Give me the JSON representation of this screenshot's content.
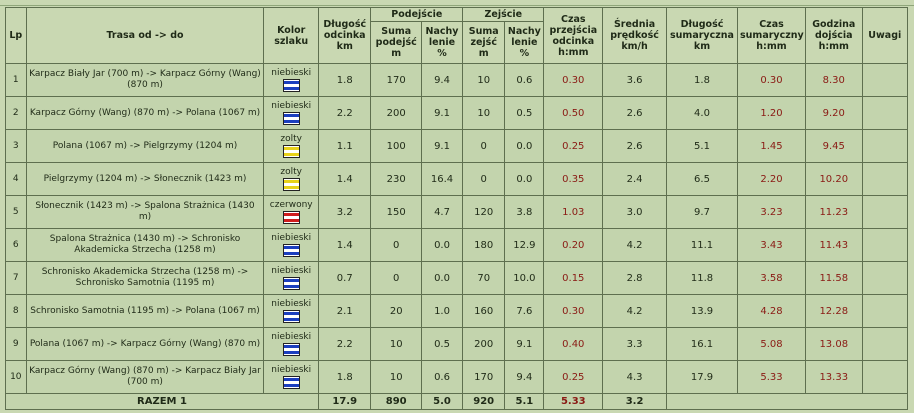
{
  "header": {
    "lp": "Lp",
    "route": "Trasa od -> do",
    "trail_color": "Kolor szlaku",
    "segment_length": "Długość odcinka km",
    "ascent_group": "Podejście",
    "ascent_sum": "Suma podejść m",
    "ascent_grade": "Nachy lenie %",
    "descent_group": "Zejście",
    "descent_sum": "Suma zejść m",
    "descent_grade": "Nachy lenie %",
    "segment_time": "Czas przejścia odcinka h:mm",
    "avg_speed": "Średnia prędkość km/h",
    "total_length": "Długość sumaryczna km",
    "total_time": "Czas sumaryczny h:mm",
    "arrival_time": "Godzina dojścia h:mm",
    "notes": "Uwagi"
  },
  "rows": [
    {
      "lp": "1",
      "route": "Karpacz Biały Jar (700 m) -> Karpacz Górny (Wang) (870 m)",
      "color_name": "niebieski",
      "color": "blue",
      "len": "1.8",
      "asc": "170",
      "asc_grade": "9.4",
      "desc": "10",
      "desc_grade": "0.6",
      "time": "0.30",
      "speed": "3.6",
      "sum_len": "1.8",
      "sum_time": "0.30",
      "arrival": "8.30",
      "notes": ""
    },
    {
      "lp": "2",
      "route": "Karpacz Górny (Wang) (870 m) -> Polana (1067 m)",
      "color_name": "niebieski",
      "color": "blue",
      "len": "2.2",
      "asc": "200",
      "asc_grade": "9.1",
      "desc": "10",
      "desc_grade": "0.5",
      "time": "0.50",
      "speed": "2.6",
      "sum_len": "4.0",
      "sum_time": "1.20",
      "arrival": "9.20",
      "notes": ""
    },
    {
      "lp": "3",
      "route": "Polana (1067 m) -> Pielgrzymy (1204 m)",
      "color_name": "zolty",
      "color": "yellow",
      "len": "1.1",
      "asc": "100",
      "asc_grade": "9.1",
      "desc": "0",
      "desc_grade": "0.0",
      "time": "0.25",
      "speed": "2.6",
      "sum_len": "5.1",
      "sum_time": "1.45",
      "arrival": "9.45",
      "notes": ""
    },
    {
      "lp": "4",
      "route": "Pielgrzymy (1204 m) -> Słonecznik (1423 m)",
      "color_name": "zolty",
      "color": "yellow",
      "len": "1.4",
      "asc": "230",
      "asc_grade": "16.4",
      "desc": "0",
      "desc_grade": "0.0",
      "time": "0.35",
      "speed": "2.4",
      "sum_len": "6.5",
      "sum_time": "2.20",
      "arrival": "10.20",
      "notes": ""
    },
    {
      "lp": "5",
      "route": "Słonecznik (1423 m) -> Spalona Strażnica (1430 m)",
      "color_name": "czerwony",
      "color": "red",
      "len": "3.2",
      "asc": "150",
      "asc_grade": "4.7",
      "desc": "120",
      "desc_grade": "3.8",
      "time": "1.03",
      "speed": "3.0",
      "sum_len": "9.7",
      "sum_time": "3.23",
      "arrival": "11.23",
      "notes": ""
    },
    {
      "lp": "6",
      "route": "Spalona Strażnica (1430 m) -> Schronisko Akademicka Strzecha (1258 m)",
      "color_name": "niebieski",
      "color": "blue",
      "len": "1.4",
      "asc": "0",
      "asc_grade": "0.0",
      "desc": "180",
      "desc_grade": "12.9",
      "time": "0.20",
      "speed": "4.2",
      "sum_len": "11.1",
      "sum_time": "3.43",
      "arrival": "11.43",
      "notes": ""
    },
    {
      "lp": "7",
      "route": "Schronisko Akademicka Strzecha (1258 m) -> Schronisko Samotnia (1195 m)",
      "color_name": "niebieski",
      "color": "blue",
      "len": "0.7",
      "asc": "0",
      "asc_grade": "0.0",
      "desc": "70",
      "desc_grade": "10.0",
      "time": "0.15",
      "speed": "2.8",
      "sum_len": "11.8",
      "sum_time": "3.58",
      "arrival": "11.58",
      "notes": ""
    },
    {
      "lp": "8",
      "route": "Schronisko Samotnia (1195 m) -> Polana (1067 m)",
      "color_name": "niebieski",
      "color": "blue",
      "len": "2.1",
      "asc": "20",
      "asc_grade": "1.0",
      "desc": "160",
      "desc_grade": "7.6",
      "time": "0.30",
      "speed": "4.2",
      "sum_len": "13.9",
      "sum_time": "4.28",
      "arrival": "12.28",
      "notes": ""
    },
    {
      "lp": "9",
      "route": "Polana (1067 m) -> Karpacz Górny (Wang) (870 m)",
      "color_name": "niebieski",
      "color": "blue",
      "len": "2.2",
      "asc": "10",
      "asc_grade": "0.5",
      "desc": "200",
      "desc_grade": "9.1",
      "time": "0.40",
      "speed": "3.3",
      "sum_len": "16.1",
      "sum_time": "5.08",
      "arrival": "13.08",
      "notes": ""
    },
    {
      "lp": "10",
      "route": "Karpacz Górny (Wang) (870 m) -> Karpacz Biały Jar (700 m)",
      "color_name": "niebieski",
      "color": "blue",
      "len": "1.8",
      "asc": "10",
      "asc_grade": "0.6",
      "desc": "170",
      "desc_grade": "9.4",
      "time": "0.25",
      "speed": "4.3",
      "sum_len": "17.9",
      "sum_time": "5.33",
      "arrival": "13.33",
      "notes": ""
    }
  ],
  "total": {
    "label": "RAZEM 1",
    "len": "17.9",
    "asc": "890",
    "asc_grade": "5.0",
    "desc": "920",
    "desc_grade": "5.1",
    "time": "5.33",
    "speed": "3.2"
  },
  "colors": {
    "background": "#c9d8b2",
    "cell_background": "#c3d4ad",
    "border": "#5e6f4f",
    "time_text": "#8a1a14",
    "trail_blue": "#1b3fbf",
    "trail_yellow": "#e8d21a",
    "trail_red": "#cf1d1d"
  }
}
